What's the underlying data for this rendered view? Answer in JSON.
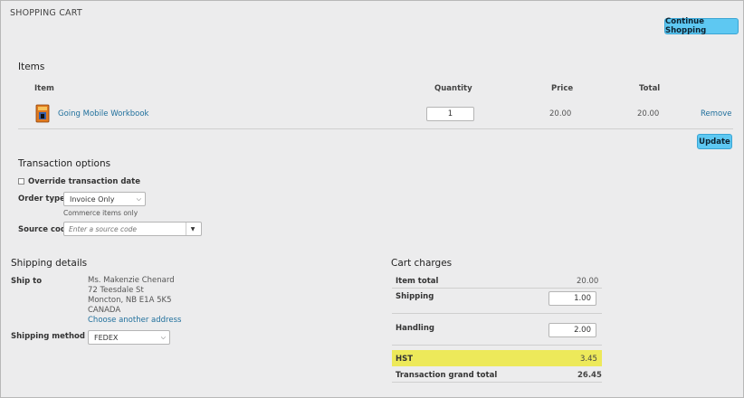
{
  "header": {
    "title": "SHOPPING CART",
    "continue_label": "Continue Shopping"
  },
  "items": {
    "heading": "Items",
    "columns": {
      "item": "Item",
      "quantity": "Quantity",
      "price": "Price",
      "total": "Total"
    },
    "rows": [
      {
        "name": "Going Mobile Workbook",
        "quantity": "1",
        "price": "20.00",
        "total": "20.00",
        "remove": "Remove"
      }
    ],
    "update_label": "Update"
  },
  "transaction": {
    "heading": "Transaction options",
    "override_label": "Override transaction date",
    "order_type_label": "Order type",
    "order_type_value": "Invoice Only",
    "order_type_hint": "Commerce items only",
    "source_code_label": "Source code",
    "source_code_placeholder": "Enter a source code"
  },
  "shipping": {
    "heading": "Shipping details",
    "ship_to_label": "Ship to",
    "address": [
      "Ms. Makenzie Chenard",
      "72 Teesdale St",
      "Moncton, NB E1A 5K5",
      "CANADA"
    ],
    "choose_address": "Choose another address",
    "method_label": "Shipping method",
    "method_value": "FEDEX"
  },
  "charges": {
    "heading": "Cart charges",
    "item_total_label": "Item total",
    "item_total_value": "20.00",
    "shipping_label": "Shipping",
    "shipping_value": "1.00",
    "handling_label": "Handling",
    "handling_value": "2.00",
    "hst_label": "HST",
    "hst_value": "3.45",
    "grand_label": "Transaction grand total",
    "grand_value": "26.45"
  },
  "colors": {
    "accent": "#5ec8f2",
    "highlight": "#ede95a",
    "link": "#1f6f9c"
  }
}
